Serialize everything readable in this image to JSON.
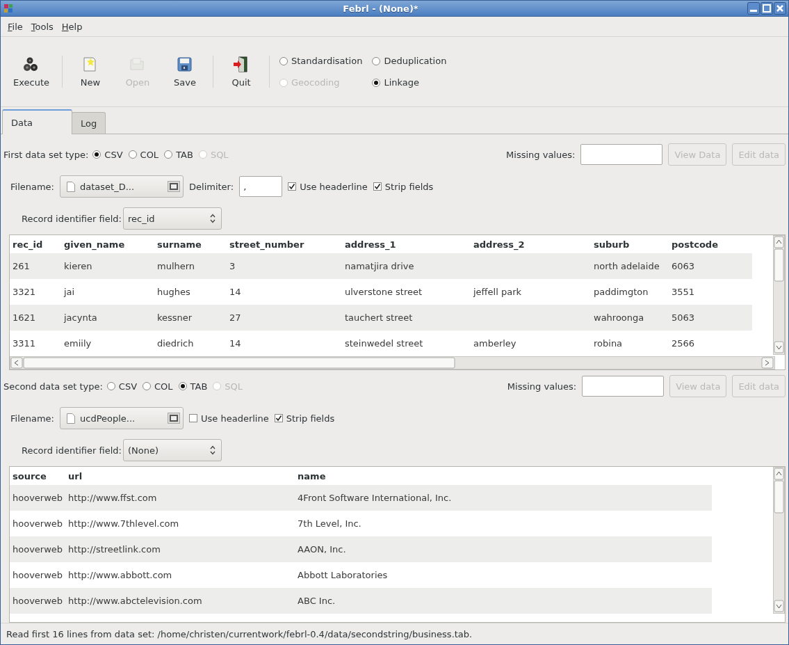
{
  "window": {
    "title": "Febrl - (None)*"
  },
  "menu": [
    {
      "label": "File"
    },
    {
      "label": "Tools"
    },
    {
      "label": "Help"
    }
  ],
  "toolbar": [
    {
      "kind": "execute",
      "label": "Execute",
      "disabled": false
    },
    {
      "kind": "new",
      "label": "New",
      "disabled": false
    },
    {
      "kind": "open",
      "label": "Open",
      "disabled": true
    },
    {
      "kind": "save",
      "label": "Save",
      "disabled": false
    },
    {
      "kind": "quit",
      "label": "Quit",
      "disabled": false
    }
  ],
  "modes": [
    {
      "label": "Standardisation",
      "selected": false,
      "disabled": false
    },
    {
      "label": "Deduplication",
      "selected": false,
      "disabled": false
    },
    {
      "label": "Geocoding",
      "selected": false,
      "disabled": true
    },
    {
      "label": "Linkage",
      "selected": true,
      "disabled": false
    }
  ],
  "tabs": [
    {
      "label": "Data",
      "selected": true
    },
    {
      "label": "Log",
      "selected": false
    }
  ],
  "datasets": [
    {
      "type_label": "First data set type:",
      "types": [
        {
          "label": "CSV",
          "selected": true,
          "disabled": false
        },
        {
          "label": "COL",
          "selected": false,
          "disabled": false
        },
        {
          "label": "TAB",
          "selected": false,
          "disabled": false
        },
        {
          "label": "SQL",
          "selected": false,
          "disabled": true
        }
      ],
      "missing_values_label": "Missing values:",
      "buttons": [
        {
          "label": "View Data",
          "disabled": true
        },
        {
          "label": "Edit data",
          "disabled": true
        }
      ],
      "filename_label": "Filename:",
      "filename": "dataset_D...",
      "delimiter_label": "Delimiter:",
      "delimiter": ",",
      "options": [
        {
          "label": "Use headerline",
          "checked": true
        },
        {
          "label": "Strip fields",
          "checked": true
        }
      ],
      "record_id_label": "Record identifier field:",
      "record_id": "rec_id",
      "table": {
        "columns": [
          "rec_id",
          "given_name",
          "surname",
          "street_number",
          "address_1",
          "address_2",
          "suburb",
          "postcode"
        ],
        "rows": [
          [
            "261",
            "kieren",
            "mulhern",
            "3",
            "namatjira drive",
            null,
            "north adelaide",
            "6063"
          ],
          [
            "3321",
            "jai",
            "hughes",
            "14",
            "ulverstone street",
            "jeffell park",
            "paddimgton",
            "3551"
          ],
          [
            "1621",
            "jacynta",
            "kessner",
            "27",
            "tauchert street",
            null,
            "wahroonga",
            "5063"
          ],
          [
            "3311",
            "emiily",
            "diedrich",
            "14",
            "steinwedel street",
            "amberley",
            "robina",
            "2566"
          ]
        ]
      }
    },
    {
      "type_label": "Second data set type:",
      "types": [
        {
          "label": "CSV",
          "selected": false,
          "disabled": false
        },
        {
          "label": "COL",
          "selected": false,
          "disabled": false
        },
        {
          "label": "TAB",
          "selected": true,
          "disabled": false
        },
        {
          "label": "SQL",
          "selected": false,
          "disabled": true
        }
      ],
      "missing_values_label": "Missing values:",
      "buttons": [
        {
          "label": "View data",
          "disabled": true
        },
        {
          "label": "Edit data",
          "disabled": true
        }
      ],
      "filename_label": "Filename:",
      "filename": "ucdPeople...",
      "options": [
        {
          "label": "Use headerline",
          "checked": false
        },
        {
          "label": "Strip fields",
          "checked": true
        }
      ],
      "record_id_label": "Record identifier field:",
      "record_id": "(None)",
      "table": {
        "columns": [
          "source",
          "url",
          "name"
        ],
        "rows": [
          [
            "hooverweb",
            "http://www.ffst.com",
            "4Front Software International, Inc."
          ],
          [
            "hooverweb",
            "http://www.7thlevel.com",
            "7th Level, Inc."
          ],
          [
            "hooverweb",
            "http://streetlink.com",
            "AAON, Inc."
          ],
          [
            "hooverweb",
            "http://www.abbott.com",
            "Abbott Laboratories"
          ],
          [
            "hooverweb",
            "http://www.abctelevision.com",
            "ABC Inc."
          ]
        ]
      }
    }
  ],
  "status_bar": "Read first 16 lines from data set: /home/christen/currentwork/febrl-0.4/data/secondstring/business.tab."
}
